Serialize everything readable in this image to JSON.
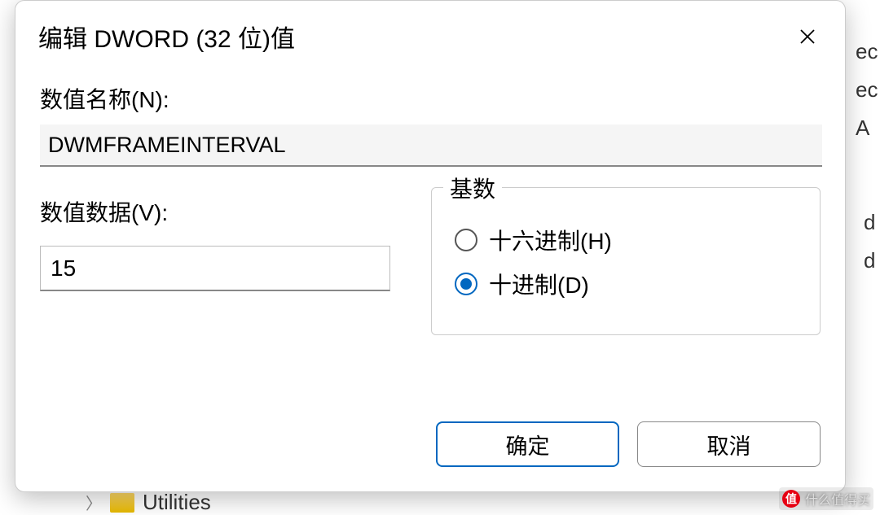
{
  "dialog": {
    "title": "编辑 DWORD (32 位)值",
    "name_label": "数值名称(N):",
    "name_value": "DWMFRAMEINTERVAL",
    "data_label": "数值数据(V):",
    "data_value": "15",
    "base_label": "基数",
    "radio_hex": "十六进制(H)",
    "radio_dec": "十进制(D)",
    "selected_base": "decimal",
    "ok_button": "确定",
    "cancel_button": "取消"
  },
  "background": {
    "folder_label": "Utilities",
    "right_fragments_top": [
      "ec",
      "ec",
      "A"
    ],
    "right_fragments_mid": [
      "d",
      "d"
    ]
  },
  "watermark": {
    "text": "什么值得买"
  }
}
